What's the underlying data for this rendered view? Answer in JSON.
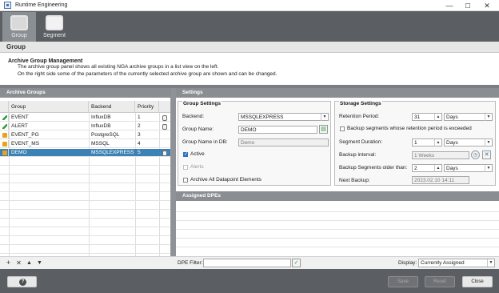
{
  "window": {
    "title": "Runtime Engineering",
    "minimize": "—",
    "maximize": "☐",
    "close": "✕"
  },
  "toolbar": {
    "items": [
      {
        "label": "Group",
        "active": true
      },
      {
        "label": "Segment",
        "active": false
      }
    ]
  },
  "page": {
    "header": "Group",
    "description_title": "Archive Group Management",
    "description_lines": [
      "The archive group panel shows all existing NGA archive groups in a list view on the left.",
      "On the right side some of the parameters of the currently selected archive group are shown and can be changed."
    ]
  },
  "archive_groups": {
    "header": "Archive Groups",
    "columns": [
      "Group",
      "Backend",
      "Priority"
    ],
    "rows": [
      {
        "group": "EVENT",
        "backend": "InfluxDB",
        "priority": "1",
        "icon": "green-bolt-icon",
        "selected": false
      },
      {
        "group": "ALERT",
        "backend": "InfluxDB",
        "priority": "2",
        "icon": "green-bolt-icon",
        "selected": false
      },
      {
        "group": "EVENT_PG",
        "backend": "PostgreSQL",
        "priority": "3",
        "icon": "orange-grid-icon",
        "selected": false
      },
      {
        "group": "EVENT_MS",
        "backend": "MSSQL",
        "priority": "4",
        "icon": "orange-grid-icon",
        "selected": false
      },
      {
        "group": "DEMO",
        "backend": "MSSQLEXPRESS",
        "priority": "5",
        "icon": "orange-grid-icon",
        "selected": true
      }
    ],
    "buttons": {
      "add": "+",
      "remove": "✕",
      "up": "▲",
      "down": "▼"
    }
  },
  "settings": {
    "header": "Settings",
    "group_settings": {
      "title": "Group Settings",
      "backend_label": "Backend:",
      "backend_value": "MSSQLEXPRESS",
      "group_name_label": "Group Name:",
      "group_name_value": "DEMO",
      "group_name_db_label": "Group Name in DB:",
      "group_name_db_value": "Demo",
      "active_label": "Active",
      "active_checked": true,
      "alerts_label": "Alerts",
      "alerts_checked": false,
      "archive_all_label": "Archive All Datapoint Elements",
      "archive_all_checked": false
    },
    "storage_settings": {
      "title": "Storage Settings",
      "retention_label": "Retention Period:",
      "retention_value": "31",
      "retention_unit": "Days",
      "backup_label": "Backup segments whose retention period is exceeded",
      "backup_checked": false,
      "segment_duration_label": "Segment Duration:",
      "segment_duration_value": "1",
      "segment_duration_unit": "Days",
      "backup_interval_label": "Backup interval:",
      "backup_interval_value": "1 Weeks",
      "backup_older_label": "Backup Segments older than:",
      "backup_older_value": "2",
      "backup_older_unit": "Days",
      "next_backup_label": "Next Backup:",
      "next_backup_value": "2023.02.10 14:11"
    },
    "assigned_header": "Assigned DPEs"
  },
  "filter": {
    "label": "DPE Filter:",
    "value": "",
    "apply_icon": "✓",
    "display_label": "Display:",
    "display_value": "Currently Assigned"
  },
  "footer": {
    "help": "?",
    "save": "Save",
    "reset": "Reset",
    "close": "Close"
  }
}
